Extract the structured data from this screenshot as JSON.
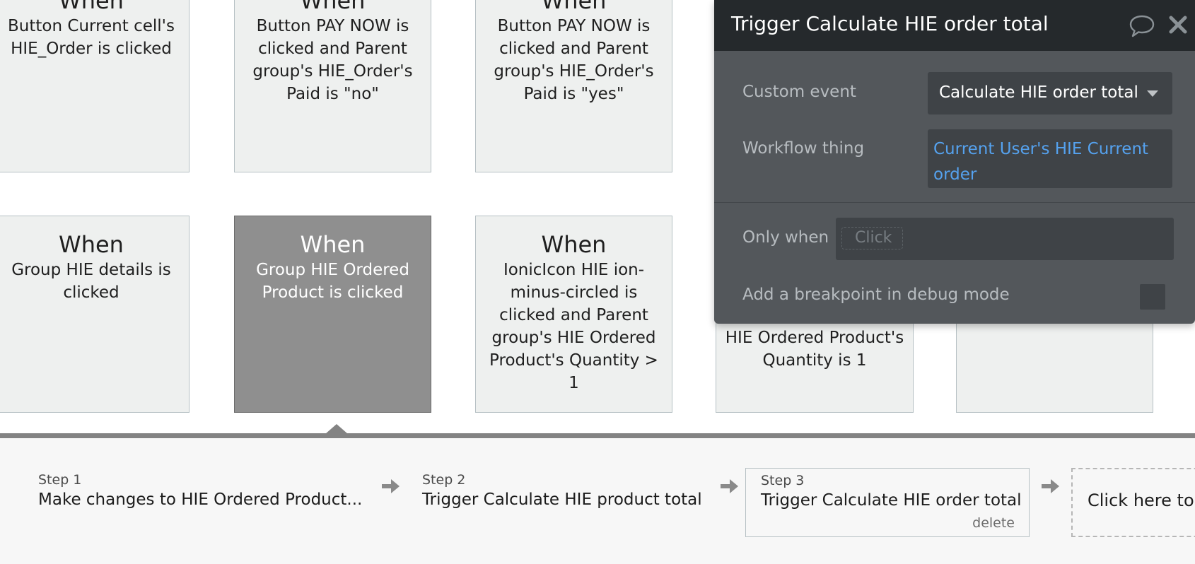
{
  "events": [
    {
      "when": "When",
      "desc": "Button Current cell's HIE_Order is clicked",
      "selected": false
    },
    {
      "when": "When",
      "desc": "Button PAY NOW is clicked and Parent group's HIE_Order's Paid is \"no\"",
      "selected": false
    },
    {
      "when": "When",
      "desc": "Button PAY NOW is clicked and Parent group's HIE_Order's Paid is \"yes\"",
      "selected": false
    },
    {
      "when": "When",
      "desc": "Group HIE details is clicked",
      "selected": false
    },
    {
      "when": "When",
      "desc": "Group HIE Ordered Product is clicked",
      "selected": true
    },
    {
      "when": "When",
      "desc": "IonicIcon HIE ion-minus-circled is clicked and Parent group's HIE Ordered Product's Quantity > 1",
      "selected": false
    },
    {
      "desc_partial": "and Parent group's HIE Ordered Product's Quantity is 1",
      "selected": false
    }
  ],
  "steps": [
    {
      "label": "Step 1",
      "title": "Make changes to HIE Ordered Product..."
    },
    {
      "label": "Step 2",
      "title": "Trigger Calculate HIE product total"
    },
    {
      "label": "Step 3",
      "title": "Trigger Calculate HIE order total",
      "delete_label": "delete",
      "current": true
    }
  ],
  "add_step_label": "Click here to a",
  "panel": {
    "title": "Trigger Calculate HIE order total",
    "comment_icon": "speech-bubble-icon",
    "close_icon": "close-icon",
    "custom_event_label": "Custom event",
    "custom_event_value": "Calculate HIE order total",
    "workflow_thing_label": "Workflow thing",
    "workflow_thing_value": "Current User's HIE Current order",
    "only_when_label": "Only when",
    "only_when_placeholder": "Click",
    "breakpoint_label": "Add a breakpoint in debug mode",
    "breakpoint_checked": false
  },
  "colors": {
    "panel_bg": "#53575b",
    "panel_header": "#25292c",
    "link_blue": "#55a2ef",
    "card_bg": "#eef0ef",
    "card_selected": "#8f8f8f"
  }
}
